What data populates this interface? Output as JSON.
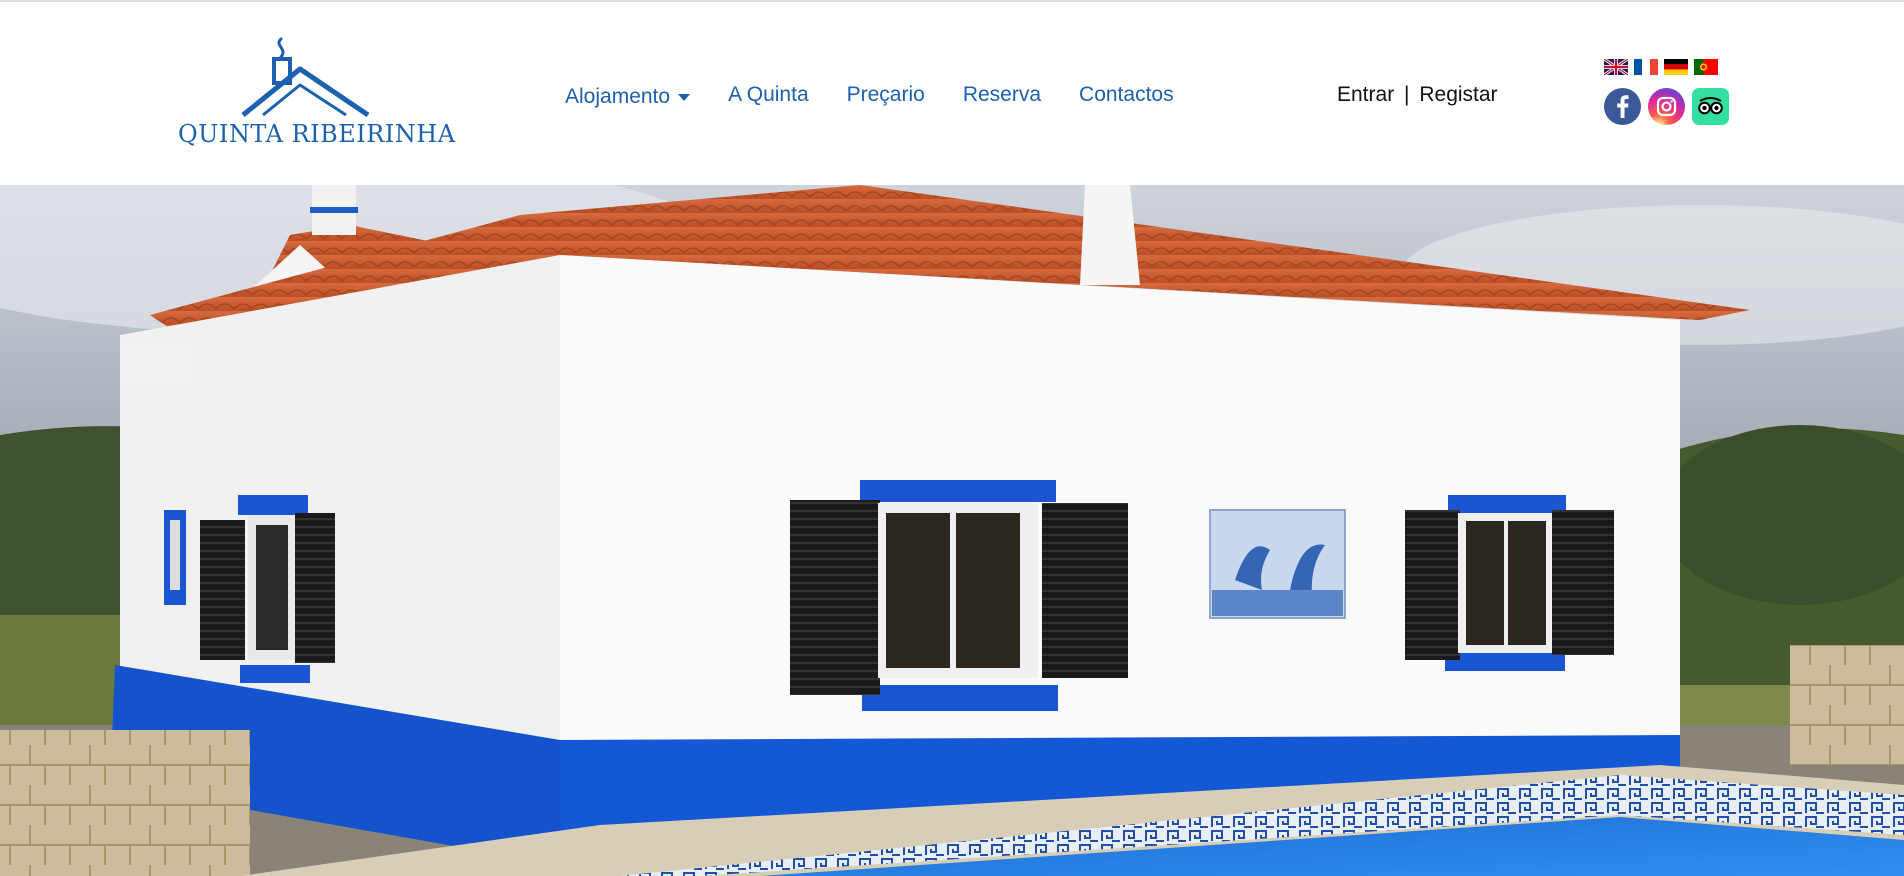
{
  "site": {
    "logo_text": "QUINTA RIBEIRINHA",
    "brand_color": "#1c61b0"
  },
  "nav": {
    "items": [
      {
        "label": "Alojamento",
        "has_dropdown": true
      },
      {
        "label": "A Quinta"
      },
      {
        "label": "Preçario"
      },
      {
        "label": "Reserva"
      },
      {
        "label": "Contactos"
      }
    ]
  },
  "auth": {
    "login_label": "Entrar",
    "separator": "|",
    "register_label": "Registar"
  },
  "languages": [
    {
      "icon": "flag-uk-icon"
    },
    {
      "icon": "flag-fr-icon"
    },
    {
      "icon": "flag-de-icon"
    },
    {
      "icon": "flag-pt-icon"
    }
  ],
  "social": [
    {
      "icon": "facebook-icon",
      "color": "#3b5998"
    },
    {
      "icon": "instagram-icon",
      "color": "#d6249f"
    },
    {
      "icon": "tripadvisor-icon",
      "color": "#34e0a1"
    }
  ]
}
